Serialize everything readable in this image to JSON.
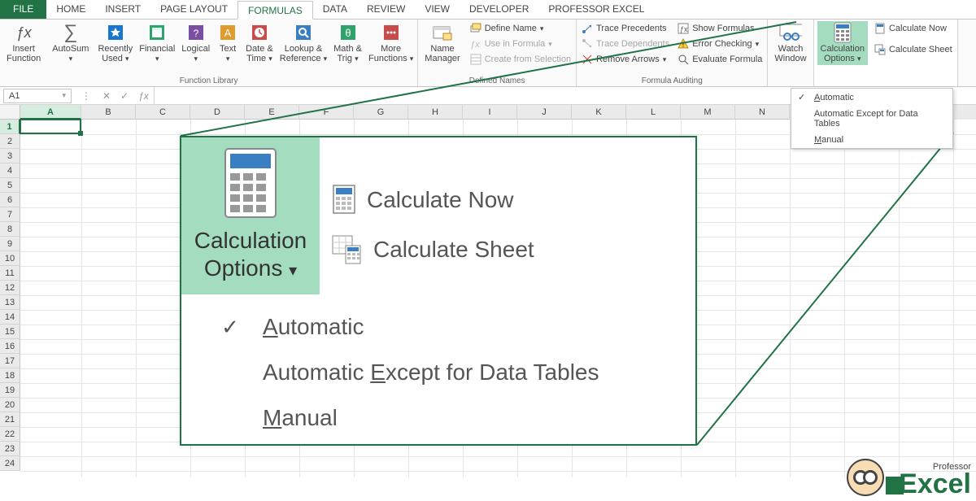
{
  "tabs": {
    "file": "FILE",
    "list": [
      "HOME",
      "INSERT",
      "PAGE LAYOUT",
      "FORMULAS",
      "DATA",
      "REVIEW",
      "VIEW",
      "DEVELOPER",
      "PROFESSOR EXCEL"
    ],
    "active": "FORMULAS"
  },
  "ribbon": {
    "group_function_library": "Function Library",
    "group_defined_names": "Defined Names",
    "group_formula_auditing": "Formula Auditing",
    "insert_function": "Insert\nFunction",
    "autosum": "AutoSum",
    "recently_used": "Recently\nUsed",
    "financial": "Financial",
    "logical": "Logical",
    "text": "Text",
    "date_time": "Date &\nTime",
    "lookup_reference": "Lookup &\nReference",
    "math_trig": "Math &\nTrig",
    "more_functions": "More\nFunctions",
    "name_manager": "Name\nManager",
    "define_name": "Define Name",
    "use_in_formula": "Use in Formula",
    "create_from_selection": "Create from Selection",
    "trace_precedents": "Trace Precedents",
    "trace_dependents": "Trace Dependents",
    "remove_arrows": "Remove Arrows",
    "show_formulas": "Show Formulas",
    "error_checking": "Error Checking",
    "evaluate_formula": "Evaluate Formula",
    "watch_window": "Watch\nWindow",
    "calculation_options": "Calculation\nOptions",
    "calculate_now": "Calculate Now",
    "calculate_sheet": "Calculate Sheet"
  },
  "calc_menu": {
    "automatic": "Automatic",
    "automatic_except": "Automatic Except for Data Tables",
    "manual": "Manual",
    "checked": "Automatic"
  },
  "formula_bar": {
    "name_box": "A1"
  },
  "columns": [
    "A",
    "B",
    "C",
    "D",
    "E",
    "F",
    "G",
    "H",
    "I",
    "J",
    "K",
    "L",
    "M",
    "N"
  ],
  "rows": [
    1,
    2,
    3,
    4,
    5,
    6,
    7,
    8,
    9,
    10,
    11,
    12,
    13,
    14,
    15,
    16,
    17,
    18,
    19,
    20,
    21,
    22,
    23,
    24
  ],
  "active_cell": "A1",
  "zoom": {
    "calculation_options": "Calculation\nOptions",
    "calculate_now": "Calculate Now",
    "calculate_sheet": "Calculate Sheet",
    "automatic": "Automatic",
    "automatic_except": "Automatic Except for Data Tables",
    "manual": "Manual"
  },
  "logo": {
    "professor": "Professor",
    "excel": "Excel"
  }
}
